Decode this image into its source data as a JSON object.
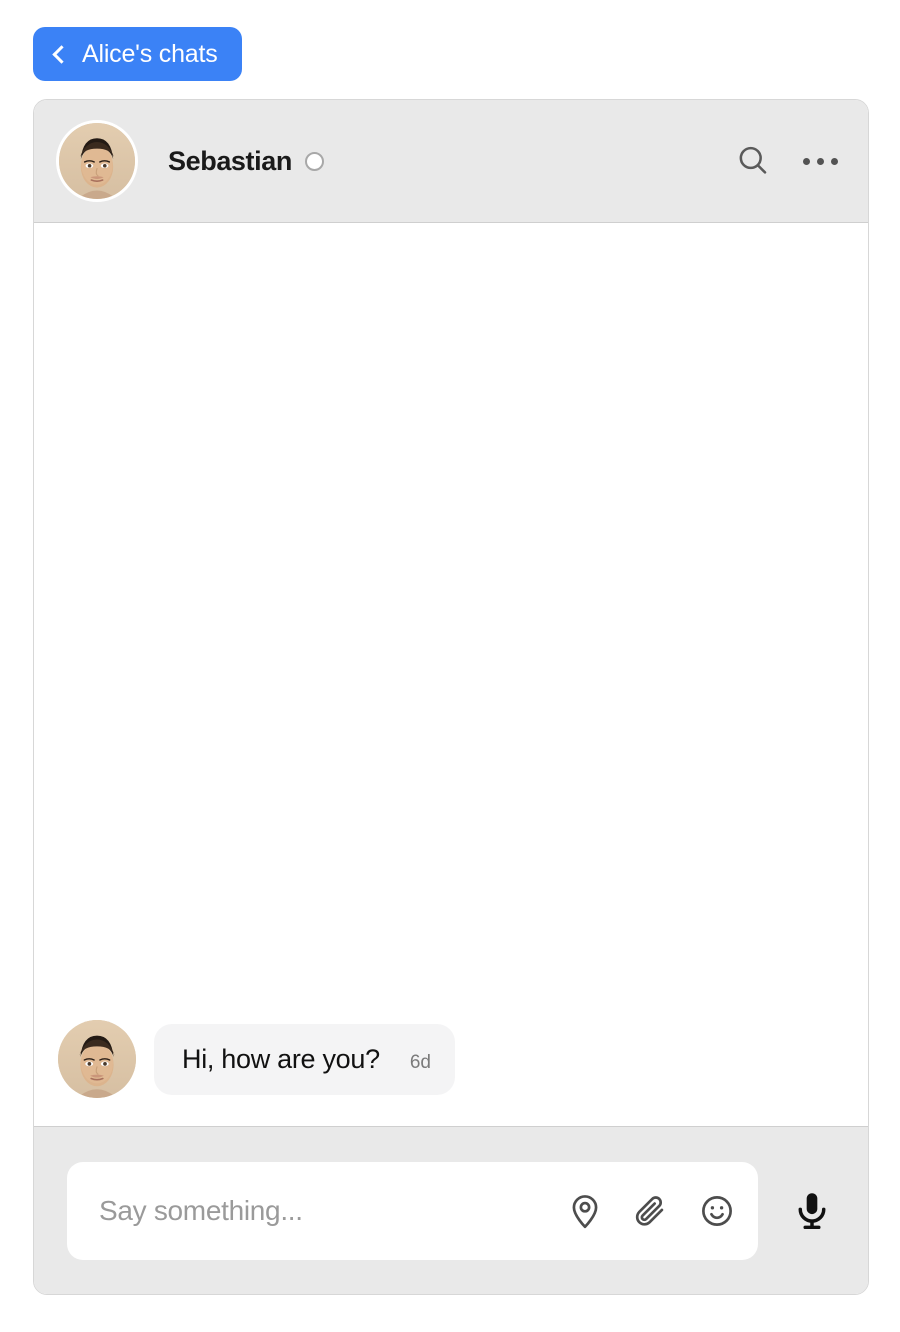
{
  "nav": {
    "back_label": "Alice's chats",
    "back_icon": "chevron-left-icon",
    "accent_color": "#3b82f6"
  },
  "header": {
    "contact_name": "Sebastian",
    "avatar_alt": "Sebastian",
    "presence": "offline",
    "presence_color": "#ffffff",
    "search_icon": "search-icon",
    "menu_icon": "more-options-icon",
    "background_color": "#e9e9e9"
  },
  "conversation": {
    "messages": [
      {
        "sender": "Sebastian",
        "text": "Hi, how are you?",
        "time": "6d",
        "side": "incoming",
        "bubble_color": "#f4f4f5"
      }
    ]
  },
  "composer": {
    "placeholder": "Say something...",
    "value": "",
    "icons": [
      {
        "name": "location-pin-icon",
        "label": "Send location"
      },
      {
        "name": "paperclip-icon",
        "label": "Attach file"
      },
      {
        "name": "emoji-smiley-icon",
        "label": "Insert emoji"
      }
    ],
    "mic_icon": "microphone-icon",
    "background_color": "#e9e9e9"
  }
}
